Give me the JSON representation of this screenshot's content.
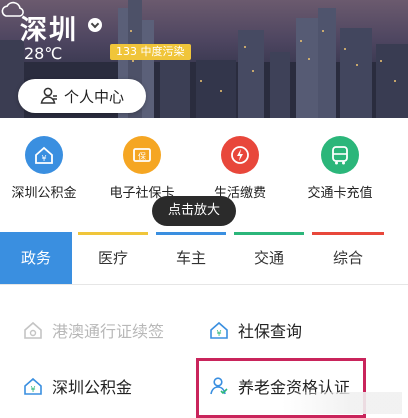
{
  "header": {
    "city": "深圳",
    "temperature": "28℃",
    "air_quality": "133 中度污染",
    "colors": {
      "aqi_badge": "#f0c53a"
    }
  },
  "personal_center": {
    "label": "个人中心"
  },
  "quick_services": [
    {
      "label": "深圳公积金",
      "icon": "house-fund-icon",
      "color": "#3a8fe0"
    },
    {
      "label": "电子社保卡",
      "icon": "social-security-card-icon",
      "color": "#f5a623"
    },
    {
      "label": "生活缴费",
      "icon": "utility-bill-icon",
      "color": "#e8473b"
    },
    {
      "label": "交通卡充值",
      "icon": "bus-card-icon",
      "color": "#2bb67a"
    }
  ],
  "zoom_tip": "点击放大",
  "tabs": [
    {
      "label": "政务",
      "active": true,
      "color": "#3a8fe0"
    },
    {
      "label": "医疗",
      "active": false,
      "color": "#f0c53a"
    },
    {
      "label": "车主",
      "active": false,
      "color": "#3a8fe0"
    },
    {
      "label": "交通",
      "active": false,
      "color": "#2bb67a"
    },
    {
      "label": "综合",
      "active": false,
      "color": "#e8473b"
    }
  ],
  "services": [
    {
      "label": "港澳通行证续签",
      "icon": "hk-macau-permit-icon",
      "state": "disabled"
    },
    {
      "label": "社保查询",
      "icon": "social-security-query-icon",
      "state": "enabled"
    },
    {
      "label": "深圳公积金",
      "icon": "house-fund-icon",
      "state": "enabled"
    },
    {
      "label": "养老金资格认证",
      "icon": "pension-certification-icon",
      "state": "enabled",
      "highlighted": true
    }
  ]
}
